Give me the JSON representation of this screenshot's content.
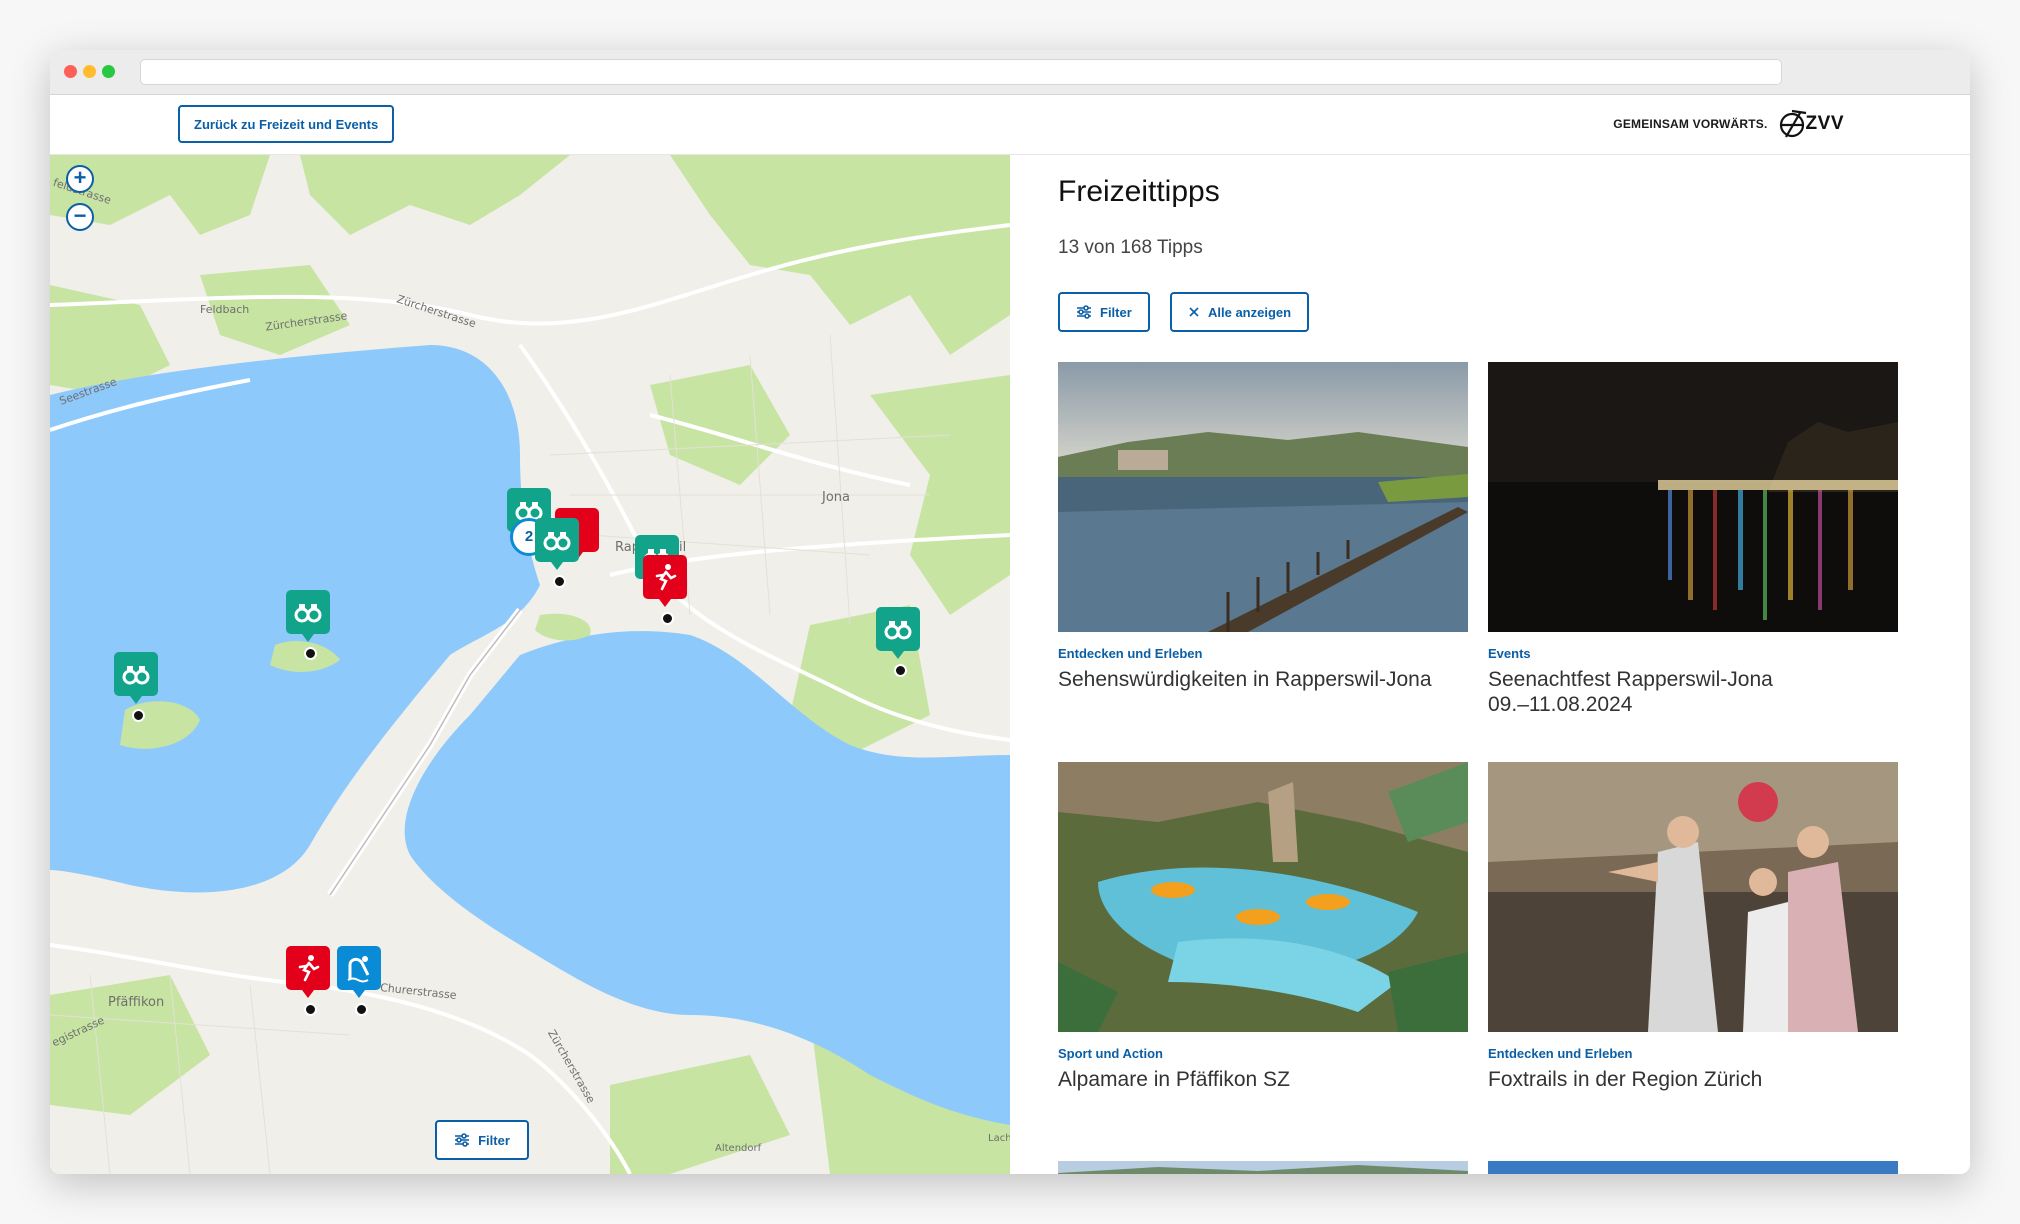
{
  "header": {
    "back_button_label": "Zurück zu Freizeit und Events",
    "slogan": "GEMEINSAM VORWÄRTS.",
    "logo_text": "ZVV"
  },
  "map": {
    "zoom_in": "+",
    "zoom_out": "−",
    "filter_label": "Filter",
    "cluster_count": "2",
    "labels": {
      "feldstrasse": "feldstrasse",
      "feldbach": "Feldbach",
      "zuercherstrasse_1": "Zürcherstrasse",
      "zuercherstrasse_2": "Zürcherstrasse",
      "seestrasse": "Seestrasse",
      "jona": "Jona",
      "rapperswil": "Rapperswil",
      "pfaeffikon": "Pfäffikon",
      "churerstrasse": "Churerstrasse",
      "zuercherstrasse_3": "Zürcherstrasse",
      "altendorf": "Altendorf",
      "lachen": "Lach",
      "gisstrasse": "egistrasse"
    },
    "colors": {
      "water": "#8ec9fb",
      "forest": "#c7e4a3",
      "land": "#f1efe9",
      "marker_teal": "#12a48a",
      "marker_red": "#e2001a",
      "marker_blue": "#0a8bd6"
    }
  },
  "panel": {
    "title": "Freizeittipps",
    "count": "13 von 168 Tipps",
    "filter_label": "Filter",
    "show_all_label": "Alle anzeigen",
    "cards": [
      {
        "category": "Entdecken und Erleben",
        "title": "Sehenswürdigkeiten in Rapperswil-Jona"
      },
      {
        "category": "Events",
        "title": "Seenachtfest Rapperswil-Jona",
        "subtitle": "09.–11.08.2024"
      },
      {
        "category": "Sport und Action",
        "title": "Alpamare in Pfäffikon SZ"
      },
      {
        "category": "Entdecken und Erleben",
        "title": "Foxtrails in der Region Zürich"
      }
    ]
  },
  "accent_color": "#0a5fa7"
}
